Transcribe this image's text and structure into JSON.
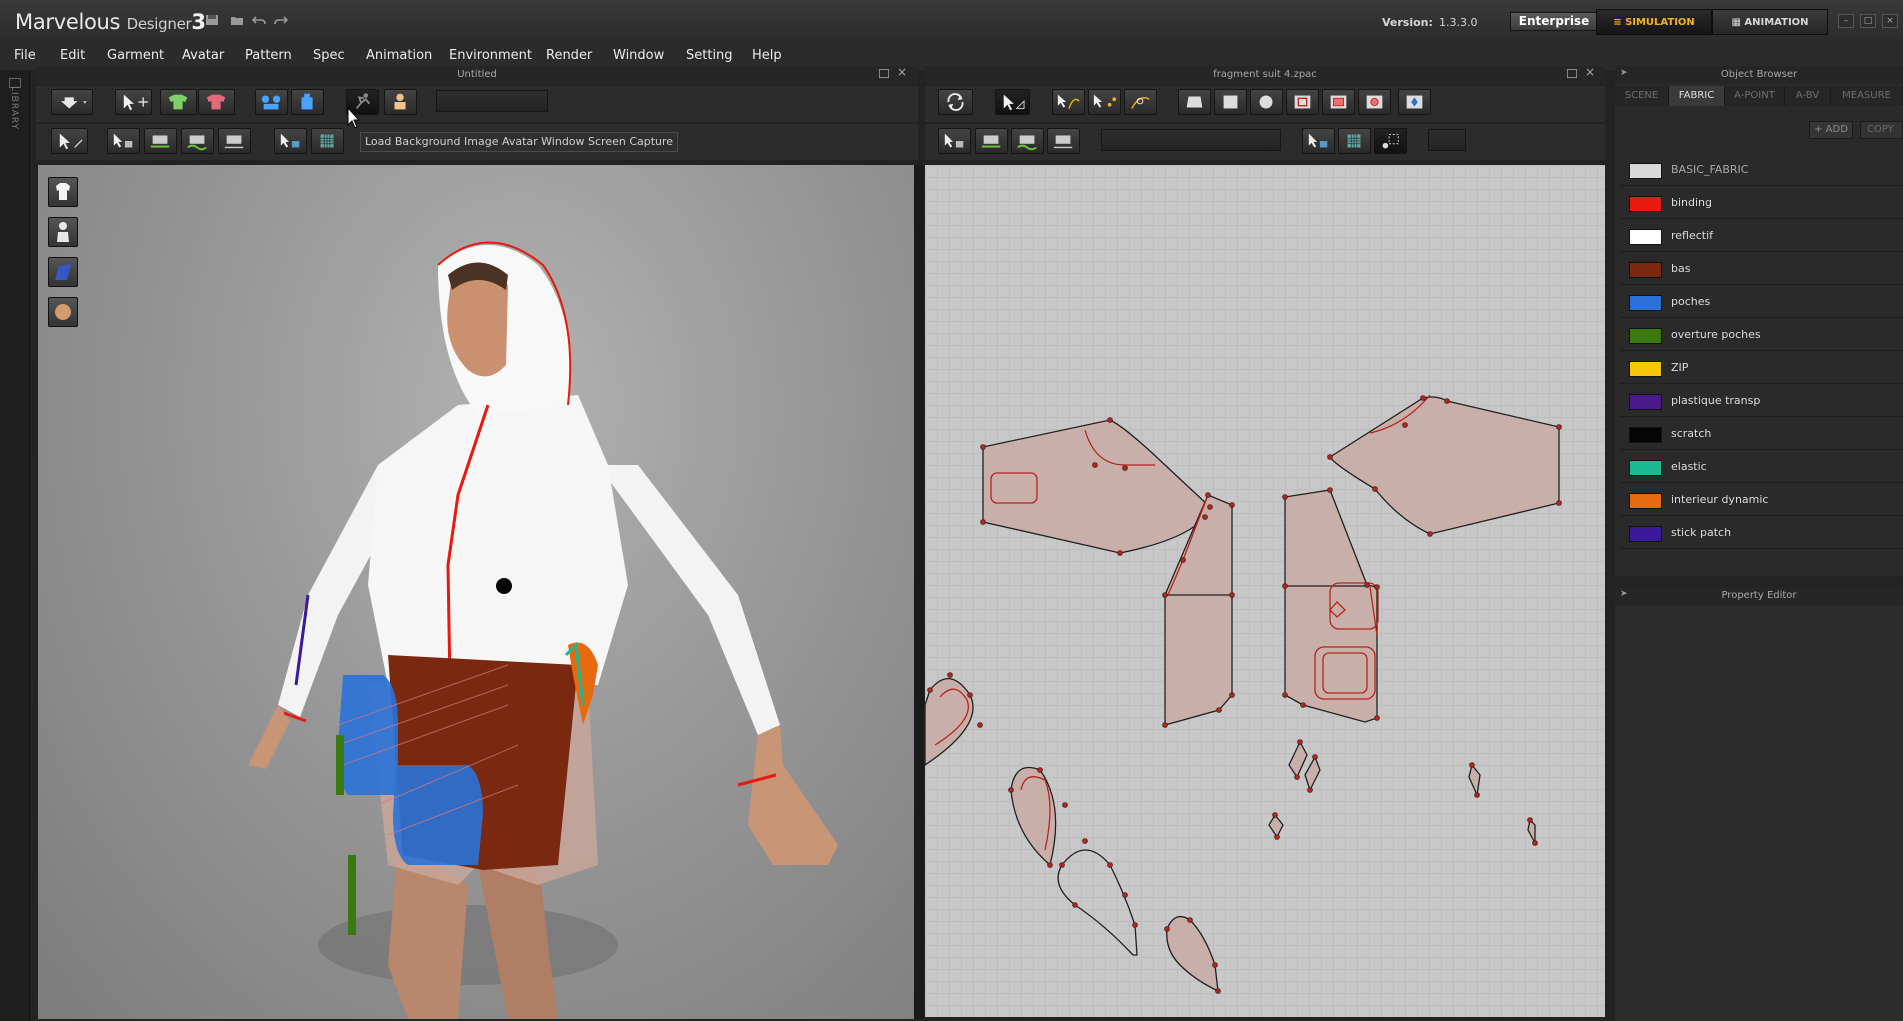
{
  "app": {
    "name": "Marvelous",
    "sub": "Designer",
    "major": "3",
    "version_label": "Version:",
    "version_value": "1.3.3.0",
    "edition": "Enterprise"
  },
  "modes": {
    "simulation": "SIMULATION",
    "animation": "ANIMATION"
  },
  "menu": [
    "File",
    "Edit",
    "Garment",
    "Avatar",
    "Pattern",
    "Spec",
    "Animation",
    "Environment",
    "Render",
    "Window",
    "Setting",
    "Help"
  ],
  "library_label": "LIBRARY",
  "panels": {
    "view3d_title": "Untitled",
    "view2d_title": "fragment suit 4.zpac",
    "object_browser_title": "Object Browser",
    "property_editor_title": "Property Editor"
  },
  "tooltip": "Load Background Image Avatar Window Screen Capture",
  "object_browser": {
    "tabs": [
      "SCENE",
      "FABRIC",
      "A-POINT",
      "A-BV",
      "MEASURE"
    ],
    "active_tab": "FABRIC",
    "add_label": "ADD",
    "copy_label": "COPY",
    "fabrics": [
      {
        "name": "BASIC_FABRIC",
        "color": "#d9d9d9"
      },
      {
        "name": "binding",
        "color": "#e8190e"
      },
      {
        "name": "reflectif",
        "color": "#ffffff"
      },
      {
        "name": "bas",
        "color": "#7a2810"
      },
      {
        "name": "poches",
        "color": "#2a72d8"
      },
      {
        "name": "overture poches",
        "color": "#3a7a0e"
      },
      {
        "name": "ZIP",
        "color": "#f5c60a"
      },
      {
        "name": "plastique transp",
        "color": "#4a1a8a"
      },
      {
        "name": "scratch",
        "color": "#050505"
      },
      {
        "name": "elastic",
        "color": "#1ab991"
      },
      {
        "name": "interieur dynamic",
        "color": "#e86a10"
      },
      {
        "name": "stick patch",
        "color": "#3a1a9a"
      }
    ]
  },
  "colors": {
    "accent": "#f3b21c",
    "pattern_fill": "#c9afaa",
    "pattern_stroke": "#202020",
    "pattern_point": "#b8231a",
    "background": "#232323"
  }
}
